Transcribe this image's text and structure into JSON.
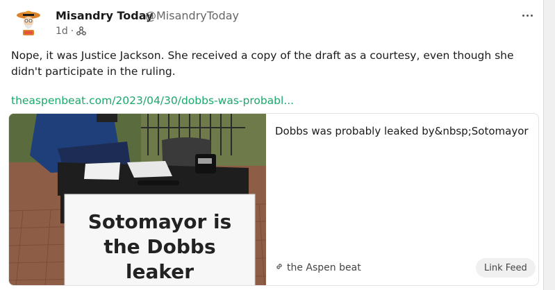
{
  "author": {
    "name": "Misandry Today",
    "handle": "@MisandryToday",
    "age": "1d",
    "separator": "·"
  },
  "post": {
    "text": "Nope, it was Justice Jackson. She received a copy of the draft as a courtesy, even though she didn't participate in the ruling.",
    "link": "theaspenbeat.com/2023/04/30/dobbs-was-probabl..."
  },
  "preview": {
    "sign_text": "Sotomayor is the Dobbs leaker",
    "title": "Dobbs was probably leaked by&nbsp;Sotomayor",
    "source": "the Aspen beat",
    "feed_button": "Link Feed"
  },
  "icons": {
    "meta": "fediverse-icon",
    "more": "more-options-icon",
    "source": "link-icon"
  },
  "colors": {
    "link": "#1aa86b",
    "text": "#1a1a1a",
    "muted": "#666666"
  }
}
